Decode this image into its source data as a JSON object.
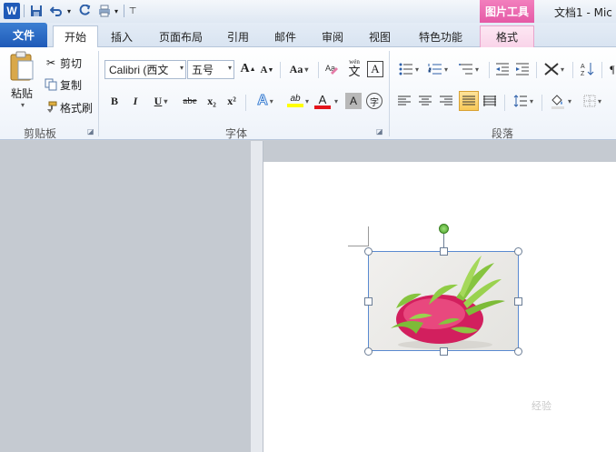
{
  "app": {
    "title": "文档1 - Mic"
  },
  "context_tool": {
    "header": "图片工具",
    "tab": "格式"
  },
  "tabs": [
    "文件",
    "开始",
    "插入",
    "页面布局",
    "引用",
    "邮件",
    "审阅",
    "视图",
    "特色功能"
  ],
  "clipboard": {
    "paste": "粘贴",
    "cut": "剪切",
    "copy": "复制",
    "format_painter": "格式刷",
    "group": "剪贴板"
  },
  "font": {
    "name": "Calibri (西文",
    "size": "五号",
    "group": "字体",
    "grow": "A",
    "shrink": "A",
    "change_case": "Aa",
    "phonetic": "wén",
    "phonetic_char": "文",
    "char_border": "A",
    "bold": "B",
    "italic": "I",
    "underline": "U",
    "strike": "abe",
    "subscript": "x₂",
    "superscript": "x²",
    "text_effect": "A",
    "highlight": "ab",
    "font_color": "A",
    "char_shading": "A",
    "enclose": "字"
  },
  "paragraph": {
    "group": "段落"
  },
  "watermark": "经验"
}
